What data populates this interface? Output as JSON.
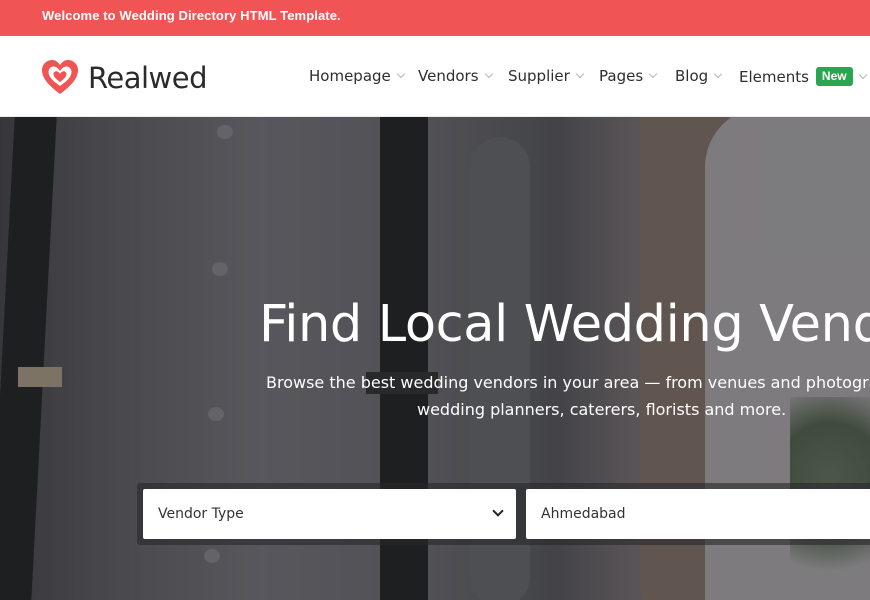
{
  "topbar": {
    "welcome_text": "Welcome to Wedding Directory HTML Template."
  },
  "brand": {
    "name": "Realwed",
    "icon": "heart-logo-icon",
    "accent_color": "#f05454"
  },
  "nav": {
    "items": [
      {
        "label": "Homepage",
        "has_dropdown": true
      },
      {
        "label": "Vendors",
        "has_dropdown": true
      },
      {
        "label": "Supplier",
        "has_dropdown": true
      },
      {
        "label": "Pages",
        "has_dropdown": true
      },
      {
        "label": "Blog",
        "has_dropdown": true
      },
      {
        "label": "Elements",
        "has_dropdown": true,
        "badge": "New"
      }
    ],
    "badge_color": "#2aa652"
  },
  "hero": {
    "title": "Find Local Wedding Vendors",
    "subtitle_line1": "Browse the best wedding vendors in your area — from venues and photographers, to",
    "subtitle_line2": "wedding planners, caterers, florists and more."
  },
  "search": {
    "vendor_type": {
      "selected": "Vendor Type"
    },
    "location": {
      "value": "Ahmedabad"
    }
  }
}
